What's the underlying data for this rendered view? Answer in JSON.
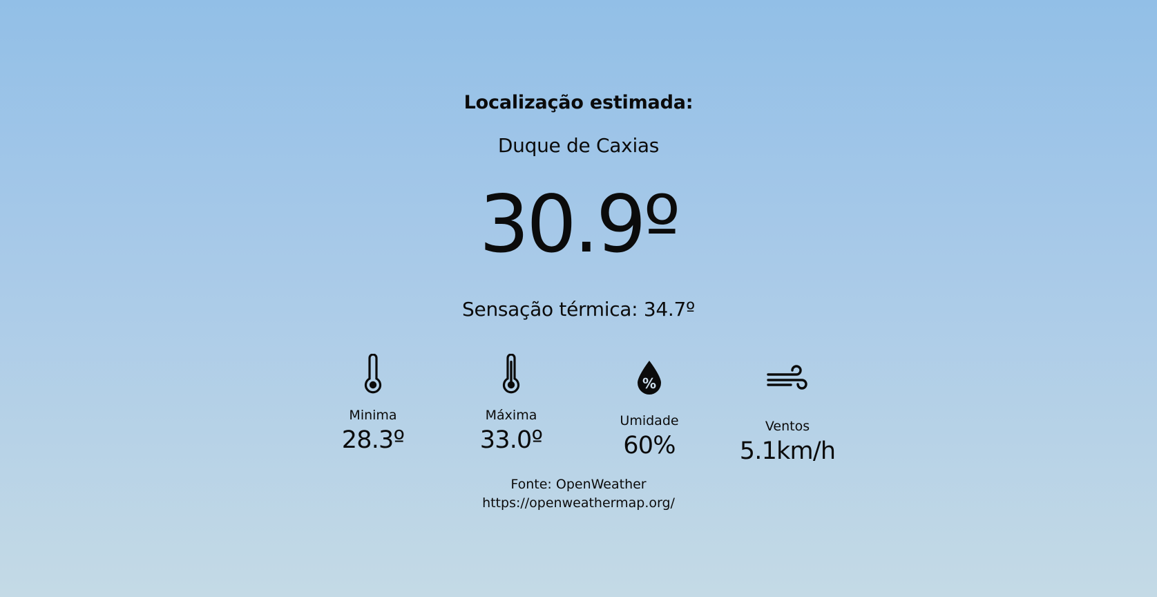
{
  "location": {
    "title": "Localização estimada:",
    "city": "Duque de Caxias"
  },
  "current": {
    "temperature": "30.9º",
    "feels_like": "Sensação térmica: 34.7º"
  },
  "stats": {
    "min": {
      "label": "Minima",
      "value": "28.3º",
      "icon": "thermometer-low-icon"
    },
    "max": {
      "label": "Máxima",
      "value": "33.0º",
      "icon": "thermometer-high-icon"
    },
    "humidity": {
      "label": "Umidade",
      "value": "60%",
      "icon": "humidity-drop-icon"
    },
    "wind": {
      "label": "Ventos",
      "value": "5.1km/h",
      "icon": "wind-icon"
    }
  },
  "source": {
    "text": "Fonte: OpenWeather",
    "url": "https://openweathermap.org/"
  },
  "colors": {
    "background_top": "#92bfe7",
    "background_bottom": "#c4dae6",
    "text": "#0b0b0b"
  }
}
